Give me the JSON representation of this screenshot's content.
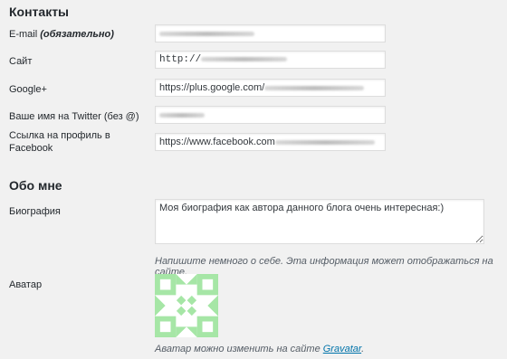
{
  "contacts": {
    "heading": "Контакты",
    "email": {
      "label": "E-mail",
      "required": "(обязательно)"
    },
    "site": {
      "label": "Сайт",
      "value": "http://"
    },
    "google": {
      "label": "Google+",
      "value": "https://plus.google.com/"
    },
    "twitter": {
      "label": "Ваше имя на Twitter (без @)"
    },
    "facebook": {
      "label_line1": "Ссылка на профиль в",
      "label_line2": "Facebook",
      "value": "https://www.facebook.com"
    }
  },
  "about": {
    "heading": "Обо мне",
    "bio": {
      "label": "Биография",
      "value": "Моя биография как автора данного блога очень интересная:)",
      "hint": "Напишите немного о себе. Эта информация может отображаться на сайте."
    },
    "avatar": {
      "label": "Аватар",
      "hint_prefix": "Аватар можно изменить на сайте ",
      "link": "Gravatar",
      "hint_suffix": ".",
      "color": "#a6e6a6"
    }
  }
}
